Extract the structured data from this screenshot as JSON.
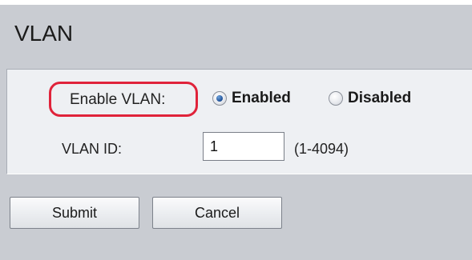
{
  "page": {
    "title": "VLAN"
  },
  "form": {
    "enable_vlan_label": "Enable VLAN:",
    "enable_options": [
      {
        "label": "Enabled",
        "checked": true
      },
      {
        "label": "Disabled",
        "checked": false
      }
    ],
    "vlan_id_label": "VLAN ID:",
    "vlan_id_value": "1",
    "vlan_id_range": "(1-4094)"
  },
  "buttons": {
    "submit_label": "Submit",
    "cancel_label": "Cancel"
  },
  "colors": {
    "background": "#c9ccd2",
    "panel": "#eef0f3",
    "highlight_ring": "#e0233a",
    "radio_selected": "#1d4f96"
  }
}
